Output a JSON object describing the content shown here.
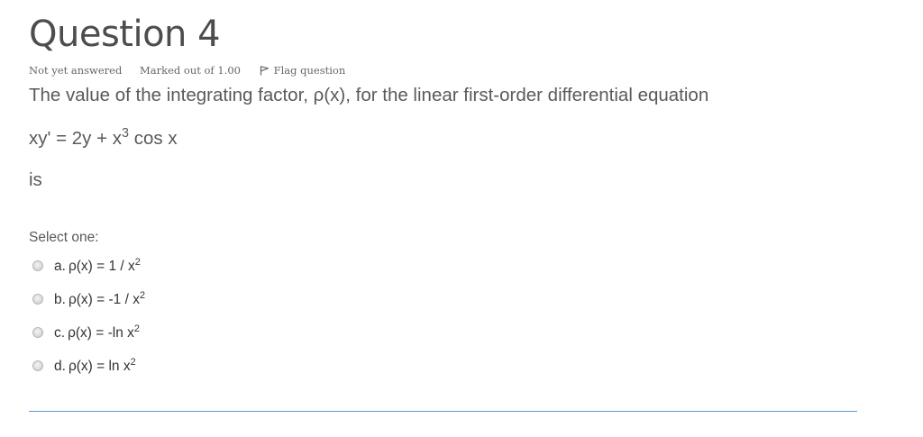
{
  "question": {
    "title": "Question 4",
    "state": "Not yet answered",
    "grade": "Marked out of 1.00",
    "flag_label": "Flag question",
    "text_line1": "The value of the integrating factor, ρ(x), for the linear first-order differential equation",
    "equation": {
      "before_sup": "xy' = 2y + x",
      "sup": "3",
      "after_sup": " cos x"
    },
    "text_line3": "is"
  },
  "answer": {
    "prompt": "Select one:",
    "options": [
      {
        "letter": "a.",
        "text": "ρ(x) = 1 / x",
        "sup": "2",
        "selected": false
      },
      {
        "letter": "b.",
        "text": "ρ(x) = -1 / x",
        "sup": "2",
        "selected": false
      },
      {
        "letter": "c.",
        "text": "ρ(x) = -ln x",
        "sup": "2",
        "selected": false
      },
      {
        "letter": "d.",
        "text": "ρ(x) = ln x",
        "sup": "2",
        "selected": false
      }
    ]
  },
  "icons": {
    "flag": "flag-icon",
    "radio": "radio-unchecked-icon"
  },
  "colors": {
    "title": "#4d4d4d",
    "question_text": "#5a5a5a",
    "answer_text": "#333333",
    "rule": "#5b9bd5"
  }
}
